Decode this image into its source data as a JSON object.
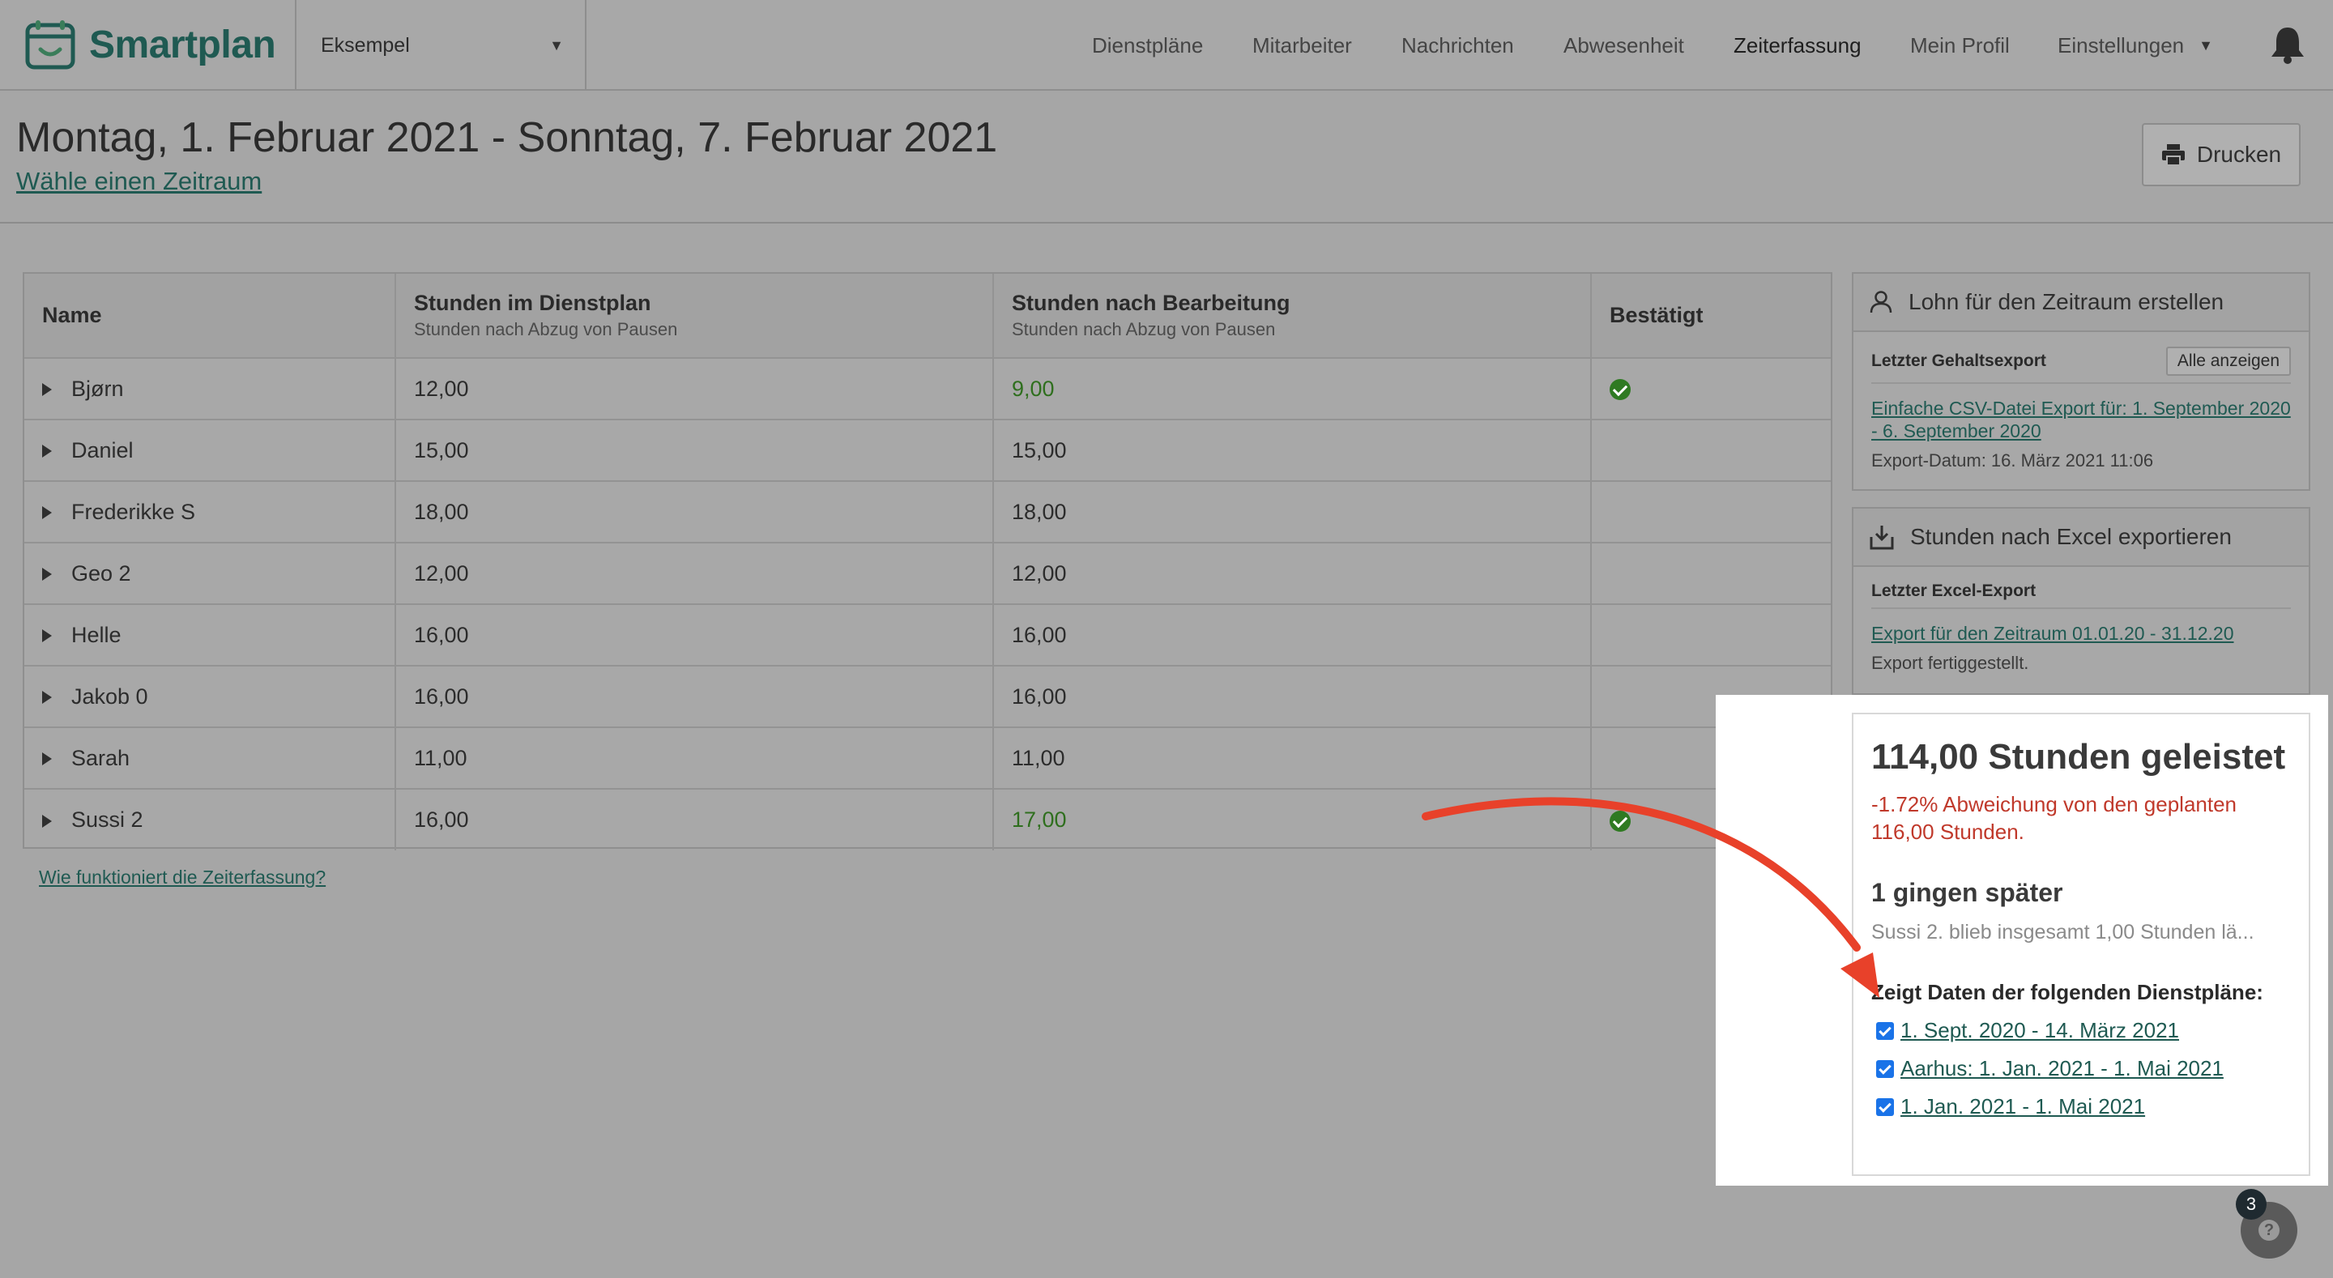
{
  "app": {
    "name": "Smartplan"
  },
  "org_select": {
    "value": "Eksempel"
  },
  "nav": {
    "items": [
      "Dienstpläne",
      "Mitarbeiter",
      "Nachrichten",
      "Abwesenheit",
      "Zeiterfassung",
      "Mein Profil",
      "Einstellungen"
    ],
    "active": "Zeiterfassung"
  },
  "page": {
    "title": "Montag, 1. Februar 2021 - Sonntag, 7. Februar 2021",
    "period_link": "Wähle einen Zeitraum",
    "print_label": "Drucken"
  },
  "table": {
    "headers": {
      "name": "Name",
      "planned": "Stunden im Dienstplan",
      "planned_sub": "Stunden nach Abzug von Pausen",
      "edited": "Stunden nach Bearbeitung",
      "edited_sub": "Stunden nach Abzug von Pausen",
      "confirmed": "Bestätigt"
    },
    "rows": [
      {
        "name": "Bjørn",
        "planned": "12,00",
        "edited": "9,00"
      },
      {
        "name": "Daniel",
        "planned": "15,00",
        "edited": "15,00"
      },
      {
        "name": "Frederikke S",
        "planned": "18,00",
        "edited": "18,00"
      },
      {
        "name": "Geo 2",
        "planned": "12,00",
        "edited": "12,00"
      },
      {
        "name": "Helle",
        "planned": "16,00",
        "edited": "16,00"
      },
      {
        "name": "Jakob 0",
        "planned": "16,00",
        "edited": "16,00"
      },
      {
        "name": "Sarah",
        "planned": "11,00",
        "edited": "11,00"
      },
      {
        "name": "Sussi 2",
        "planned": "16,00",
        "edited": "17,00"
      }
    ],
    "help_link": "Wie funktioniert die Zeiterfassung?"
  },
  "salary_panel": {
    "title": "Lohn für den Zeitraum erstellen",
    "label": "Letzter Gehaltsexport",
    "button": "Alle anzeigen",
    "link": "Einfache CSV-Datei Export für: 1. September 2020 - 6. September 2020",
    "date": "Export-Datum: 16. März 2021 11:06"
  },
  "excel_panel": {
    "title": "Stunden nach Excel exportieren",
    "label": "Letzter Excel-Export",
    "link": "Export für den Zeitraum 01.01.20 - 31.12.20",
    "status": "Export fertiggestellt."
  },
  "stats": {
    "title": "114,00 Stunden geleistet",
    "deviation": "-1.72% Abweichung von den geplanten 116,00 Stunden.",
    "late_title": "1 gingen später",
    "late_detail": "Sussi 2. blieb insgesamt 1,00 Stunden lä...",
    "plans_label": "Zeigt Daten der folgenden Dienstpläne:",
    "plans": [
      "1. Sept. 2020 - 14. März 2021",
      "Aarhus: 1. Jan. 2021 - 1. Mai 2021",
      "1. Jan. 2021 - 1. Mai 2021"
    ]
  },
  "help": {
    "badge": "3",
    "symbol": "?"
  },
  "colors": {
    "brand": "#1f5a52",
    "positive": "#2f7a22",
    "negative": "#c0392b",
    "arrow": "#e8412a"
  }
}
